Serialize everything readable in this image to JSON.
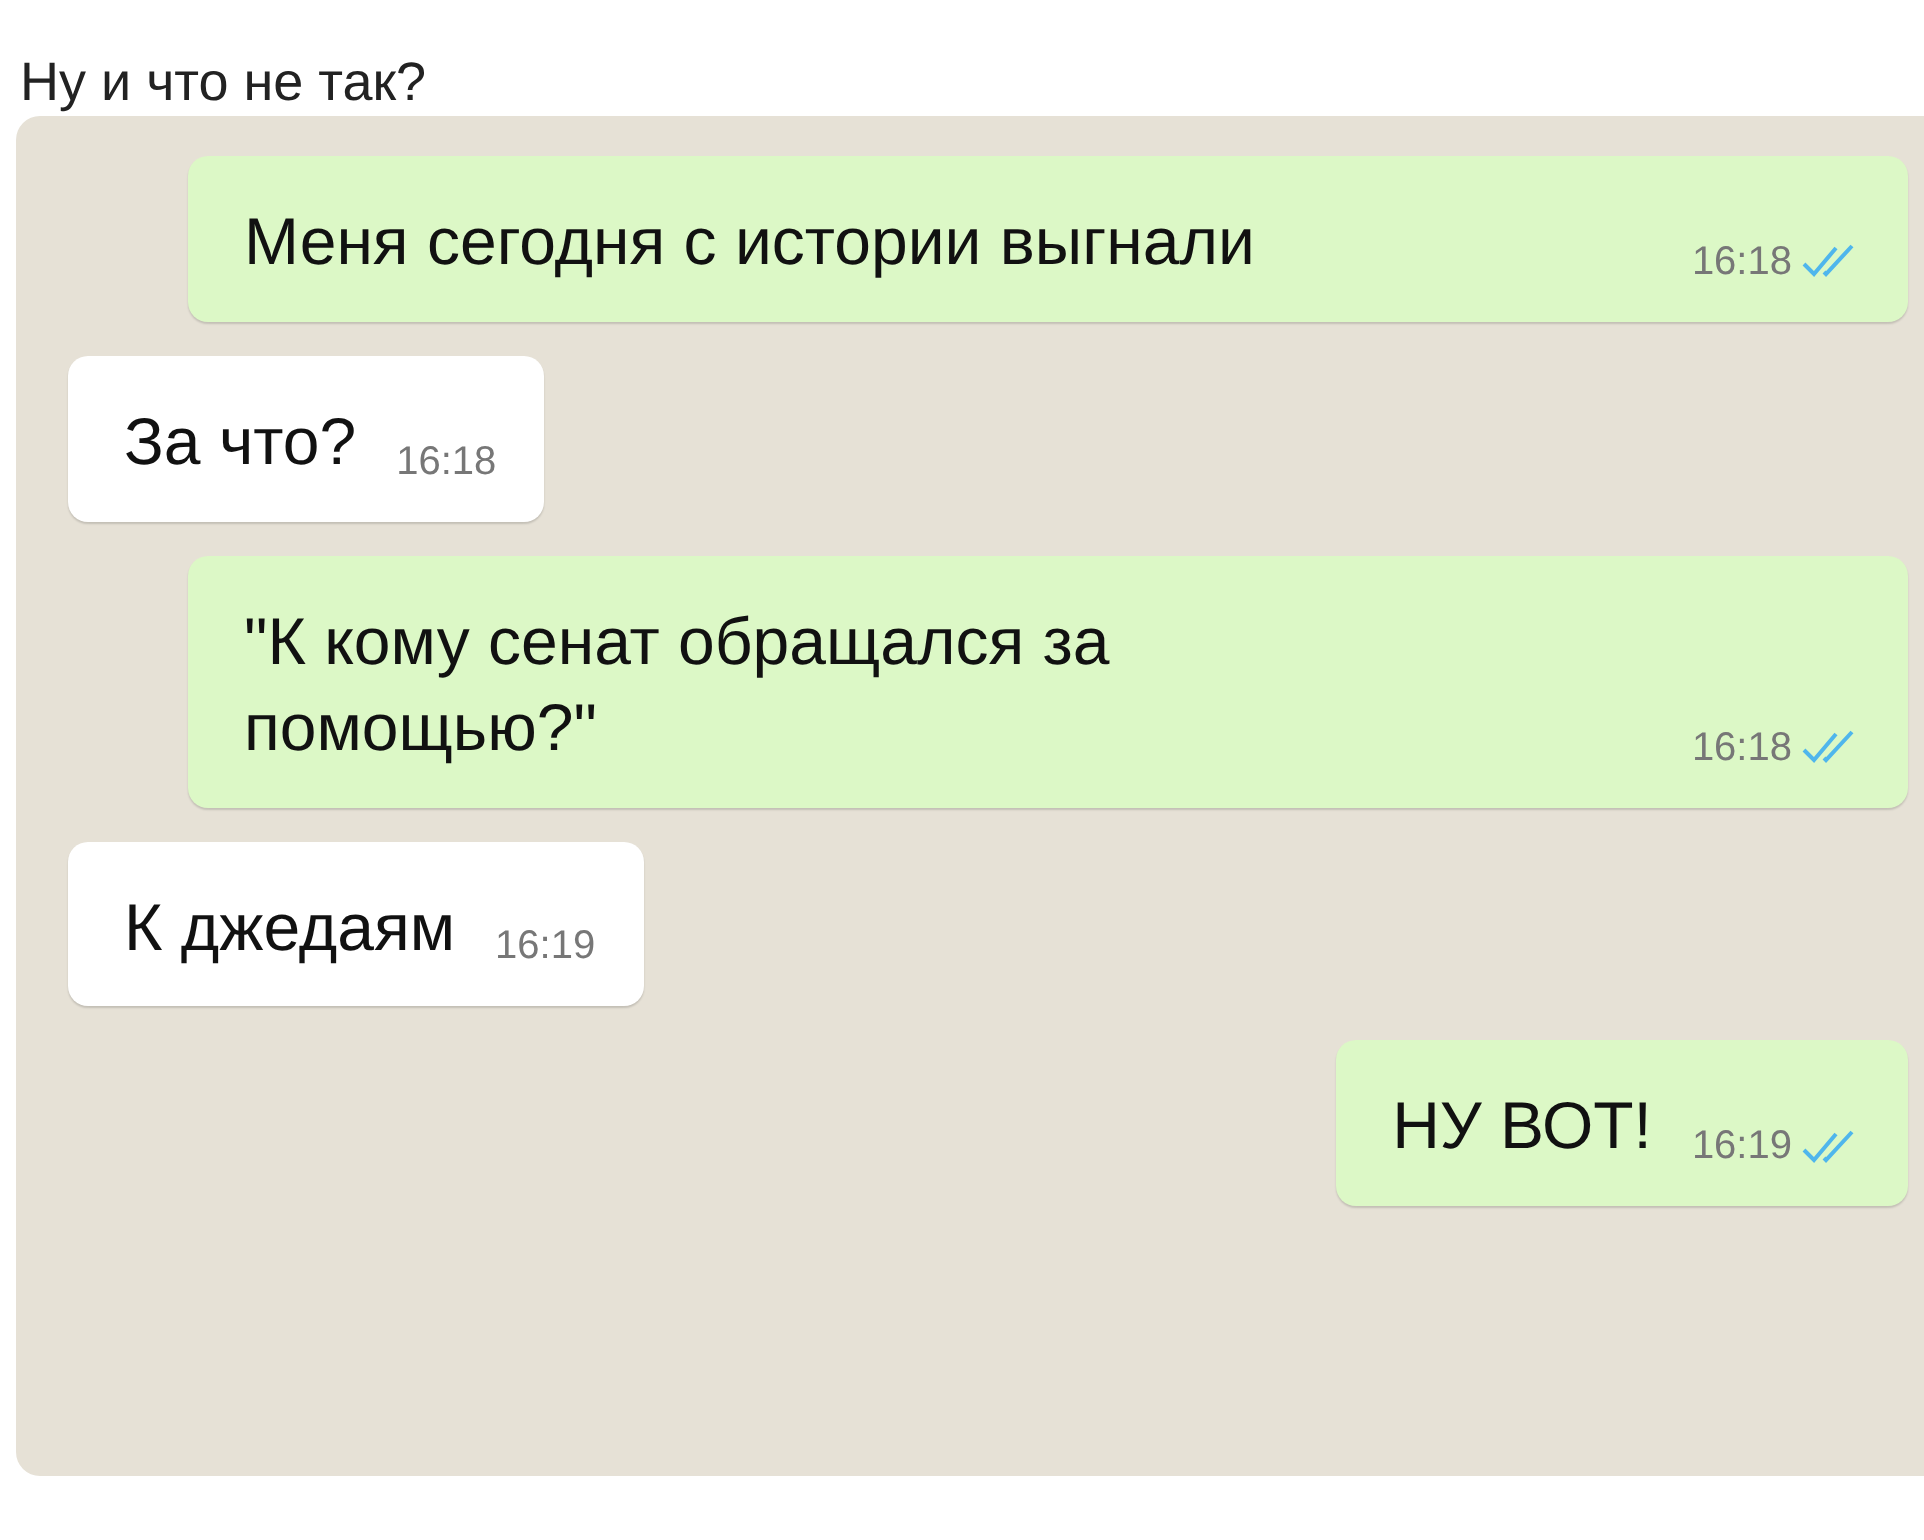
{
  "caption": "Ну и что не так?",
  "messages": [
    {
      "kind": "outgoing",
      "text": "Меня сегодня с истории выгнали",
      "time": "16:18",
      "read": true
    },
    {
      "kind": "incoming",
      "text": "За что?",
      "time": "16:18"
    },
    {
      "kind": "outgoing",
      "text": "\"К кому сенат обращался за помощью?\"",
      "time": "16:18",
      "read": true
    },
    {
      "kind": "incoming",
      "text": "К джедаям",
      "time": "16:19"
    },
    {
      "kind": "outgoing",
      "text": "НУ ВОТ!",
      "time": "16:19",
      "read": true
    }
  ]
}
